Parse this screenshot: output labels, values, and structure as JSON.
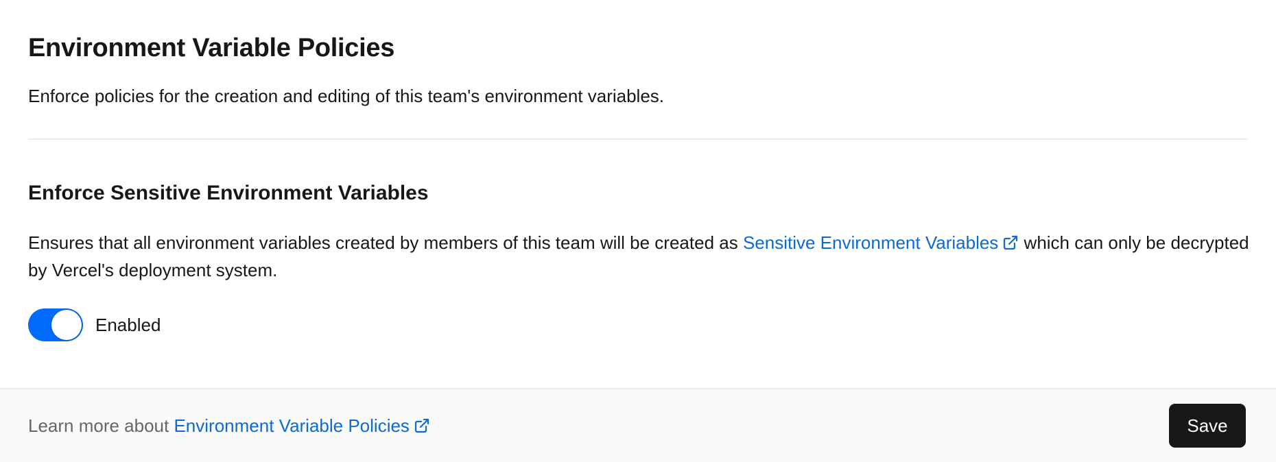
{
  "header": {
    "title": "Environment Variable Policies",
    "description": "Enforce policies for the creation and editing of this team's environment variables."
  },
  "policy": {
    "title": "Enforce Sensitive Environment Variables",
    "description_before": "Ensures that all environment variables created by members of this team will be created as ",
    "link_text": "Sensitive Environment Variables",
    "description_after": " which can only be decrypted by Vercel's deployment system.",
    "toggle": {
      "enabled": true,
      "label": "Enabled"
    }
  },
  "footer": {
    "learn_more_prefix": "Learn more about ",
    "learn_more_link": "Environment Variable Policies",
    "save_label": "Save"
  },
  "colors": {
    "link": "#0a6ad8",
    "toggle_on": "#006bfd",
    "button_bg": "#171717",
    "footer_bg": "#fafafa"
  },
  "icons": {
    "external_link": "external-link-icon"
  }
}
